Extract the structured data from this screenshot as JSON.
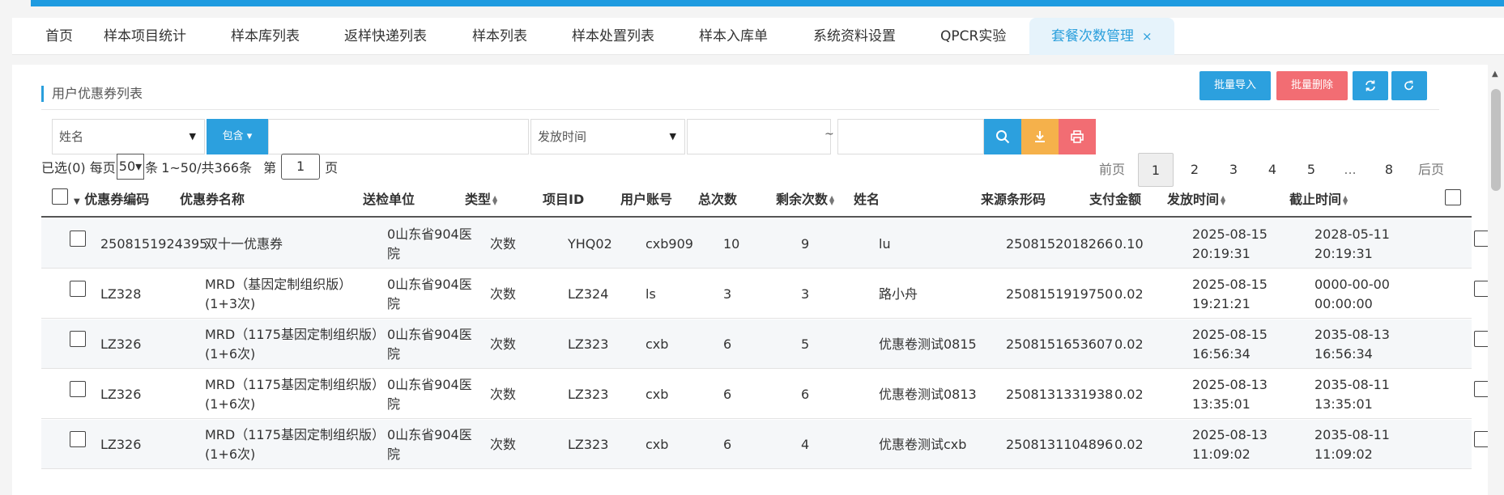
{
  "tabs": [
    {
      "label": "首页"
    },
    {
      "label": "样本项目统计"
    },
    {
      "label": "样本库列表"
    },
    {
      "label": "返样快递列表"
    },
    {
      "label": "样本列表"
    },
    {
      "label": "样本处置列表"
    },
    {
      "label": "样本入库单"
    },
    {
      "label": "系统资料设置"
    },
    {
      "label": "QPCR实验"
    },
    {
      "label": "套餐次数管理",
      "active": true
    }
  ],
  "section_title": "用户优惠券列表",
  "toolbar": {
    "import_label": "批量导入",
    "delete_label": "批量删除"
  },
  "filter": {
    "field_select": "姓名",
    "operator_label": "包含",
    "keyword_value": "",
    "time_select": "发放时间",
    "date_from": "",
    "tilde": "~",
    "date_to": ""
  },
  "pager": {
    "selected_text": "已选(0)",
    "per_page_label": "每页",
    "per_page_value": "50",
    "per_page_unit": "条",
    "range_text": "1~50/共366条",
    "page_prefix": "第",
    "page_value": "1",
    "page_suffix": "页",
    "prev_label": "前页",
    "next_label": "后页",
    "pages": [
      "1",
      "2",
      "3",
      "4",
      "5",
      "...",
      "8"
    ],
    "current": "1"
  },
  "table": {
    "columns": [
      "优惠券编码",
      "优惠券名称",
      "送检单位",
      "类型",
      "项目ID",
      "用户账号",
      "总次数",
      "剩余次数",
      "姓名",
      "来源条形码",
      "支付金额",
      "发放时间",
      "截止时间"
    ],
    "rows": [
      {
        "code": "2508151924395",
        "name": "双十一优惠券",
        "unit": "0山东省904医院",
        "type": "次数",
        "project_id": "YHQ02",
        "account": "cxb909",
        "total": "10",
        "remaining": "9",
        "person": "lu",
        "barcode": "2508152018266",
        "amount": "0.10",
        "issue_date": "2025-08-15",
        "issue_time": "20:19:31",
        "expire_date": "2028-05-11",
        "expire_time": "20:19:31"
      },
      {
        "code": "LZ328",
        "name": "MRD（基因定制组织版）(1+3次)",
        "unit": "0山东省904医院",
        "type": "次数",
        "project_id": "LZ324",
        "account": "ls",
        "total": "3",
        "remaining": "3",
        "person": "路小舟",
        "barcode": "2508151919750",
        "amount": "0.02",
        "issue_date": "2025-08-15",
        "issue_time": "19:21:21",
        "expire_date": "0000-00-00",
        "expire_time": "00:00:00"
      },
      {
        "code": "LZ326",
        "name": "MRD（1175基因定制组织版）(1+6次)",
        "unit": "0山东省904医院",
        "type": "次数",
        "project_id": "LZ323",
        "account": "cxb",
        "total": "6",
        "remaining": "5",
        "person": "优惠卷测试0815",
        "barcode": "2508151653607",
        "amount": "0.02",
        "issue_date": "2025-08-15",
        "issue_time": "16:56:34",
        "expire_date": "2035-08-13",
        "expire_time": "16:56:34"
      },
      {
        "code": "LZ326",
        "name": "MRD（1175基因定制组织版）(1+6次)",
        "unit": "0山东省904医院",
        "type": "次数",
        "project_id": "LZ323",
        "account": "cxb",
        "total": "6",
        "remaining": "6",
        "person": "优惠卷测试0813",
        "barcode": "2508131331938",
        "amount": "0.02",
        "issue_date": "2025-08-13",
        "issue_time": "13:35:01",
        "expire_date": "2035-08-11",
        "expire_time": "13:35:01"
      },
      {
        "code": "LZ326",
        "name": "MRD（1175基因定制组织版）(1+6次)",
        "unit": "0山东省904医院",
        "type": "次数",
        "project_id": "LZ323",
        "account": "cxb",
        "total": "6",
        "remaining": "4",
        "person": "优惠卷测试cxb",
        "barcode": "2508131104896",
        "amount": "0.02",
        "issue_date": "2025-08-13",
        "issue_time": "11:09:02",
        "expire_date": "2035-08-11",
        "expire_time": "11:09:02"
      }
    ]
  },
  "colors": {
    "accent": "#2ca0de",
    "danger": "#f26d73",
    "warning": "#f5b14b"
  }
}
